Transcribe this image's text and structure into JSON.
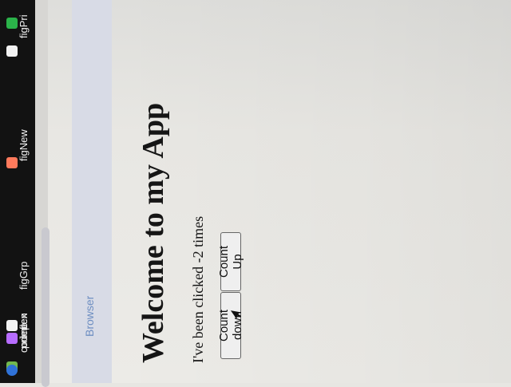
{
  "bookmarks": [
    {
      "label": "figPri",
      "icon": "bookmark-icon"
    },
    {
      "label": "figNew",
      "icon": "figma-icon"
    },
    {
      "label": "figGrp",
      "icon": "figma-icon"
    },
    {
      "label": "codepen",
      "icon": "codepen-icon"
    },
    {
      "label": "flex",
      "icon": "flex-icon"
    },
    {
      "label": "prime",
      "icon": "prime-icon"
    }
  ],
  "browser": {
    "label": "Browser"
  },
  "app": {
    "title": "Welcome to my App",
    "click_text": "I've been clicked -2 times",
    "count_down_label": "Count down",
    "count_up_label": "Count Up"
  },
  "colors": {
    "bookmark_bg": "#121212",
    "browser_label": "#6f8fc2",
    "browser_panel": "#d8dbe6"
  }
}
